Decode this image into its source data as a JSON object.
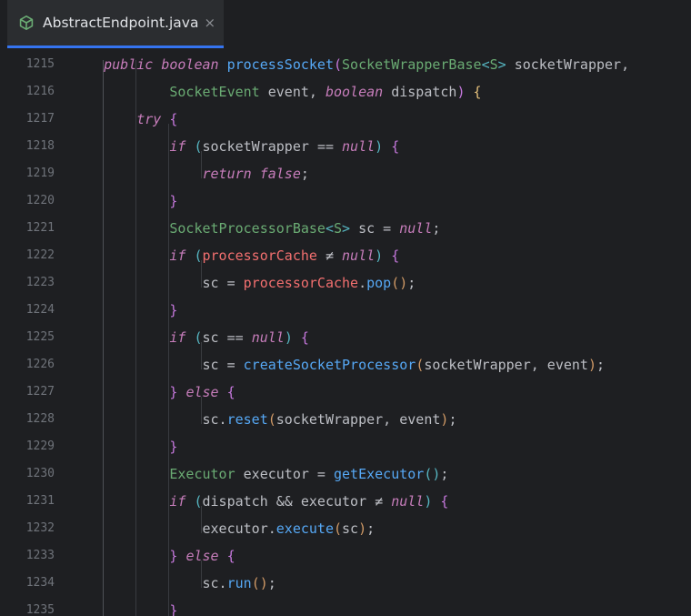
{
  "tab": {
    "icon": "java-class-icon",
    "filename": "AbstractEndpoint.java",
    "close": "×"
  },
  "colors": {
    "background": "#1e1f22",
    "tab_bg": "#2b2d30",
    "tab_active_underline": "#3574f0",
    "line_number": "#6f737a",
    "keyword": "#c77dbb",
    "class_name": "#6aab73",
    "method": "#56a8f5",
    "variable": "#f26f6f"
  },
  "lines": [
    {
      "num": "1215",
      "tokens": [
        [
          "t",
          "    "
        ],
        [
          "kwp",
          "public "
        ],
        [
          "kwp",
          "boolean "
        ],
        [
          "fn",
          "processSocket"
        ],
        [
          "br2",
          "("
        ],
        [
          "cls",
          "SocketWrapperBase"
        ],
        [
          "br3",
          "<"
        ],
        [
          "cls",
          "S"
        ],
        [
          "br3",
          "> "
        ],
        [
          "t",
          "socketWrapper,"
        ]
      ]
    },
    {
      "num": "1216",
      "tokens": [
        [
          "t",
          "            "
        ],
        [
          "cls",
          "SocketEvent "
        ],
        [
          "t",
          "event, "
        ],
        [
          "kwp",
          "boolean "
        ],
        [
          "t",
          "dispatch"
        ],
        [
          "br2",
          ") "
        ],
        [
          "br1",
          "{"
        ]
      ]
    },
    {
      "num": "1217",
      "tokens": [
        [
          "t",
          "        "
        ],
        [
          "kwp",
          "try "
        ],
        [
          "br2",
          "{"
        ]
      ]
    },
    {
      "num": "1218",
      "tokens": [
        [
          "t",
          "            "
        ],
        [
          "kwp",
          "if "
        ],
        [
          "br3",
          "("
        ],
        [
          "t",
          "socketWrapper "
        ],
        [
          "t",
          "== "
        ],
        [
          "kwp",
          "null"
        ],
        [
          "br3",
          ") "
        ],
        [
          "br2",
          "{"
        ]
      ]
    },
    {
      "num": "1219",
      "tokens": [
        [
          "t",
          "                "
        ],
        [
          "kwp",
          "return "
        ],
        [
          "kwp",
          "false"
        ],
        [
          "t",
          ";"
        ]
      ]
    },
    {
      "num": "1220",
      "tokens": [
        [
          "t",
          "            "
        ],
        [
          "br2",
          "}"
        ]
      ]
    },
    {
      "num": "1221",
      "tokens": [
        [
          "t",
          "            "
        ],
        [
          "cls",
          "SocketProcessorBase"
        ],
        [
          "br3",
          "<"
        ],
        [
          "cls",
          "S"
        ],
        [
          "br3",
          "> "
        ],
        [
          "t",
          "sc = "
        ],
        [
          "kwp",
          "null"
        ],
        [
          "t",
          ";"
        ]
      ]
    },
    {
      "num": "1222",
      "tokens": [
        [
          "t",
          "            "
        ],
        [
          "kwp",
          "if "
        ],
        [
          "br3",
          "("
        ],
        [
          "var",
          "processorCache "
        ],
        [
          "t",
          "≠ "
        ],
        [
          "kwp",
          "null"
        ],
        [
          "br3",
          ") "
        ],
        [
          "br2",
          "{"
        ]
      ]
    },
    {
      "num": "1223",
      "tokens": [
        [
          "t",
          "                "
        ],
        [
          "t",
          "sc = "
        ],
        [
          "var",
          "processorCache"
        ],
        [
          "t",
          "."
        ],
        [
          "fn",
          "pop"
        ],
        [
          "br4",
          "()"
        ],
        [
          "t",
          ";"
        ]
      ]
    },
    {
      "num": "1224",
      "tokens": [
        [
          "t",
          "            "
        ],
        [
          "br2",
          "}"
        ]
      ]
    },
    {
      "num": "1225",
      "tokens": [
        [
          "t",
          "            "
        ],
        [
          "kwp",
          "if "
        ],
        [
          "br3",
          "("
        ],
        [
          "t",
          "sc == "
        ],
        [
          "kwp",
          "null"
        ],
        [
          "br3",
          ") "
        ],
        [
          "br2",
          "{"
        ]
      ]
    },
    {
      "num": "1226",
      "tokens": [
        [
          "t",
          "                "
        ],
        [
          "t",
          "sc = "
        ],
        [
          "fn",
          "createSocketProcessor"
        ],
        [
          "br4",
          "("
        ],
        [
          "t",
          "socketWrapper, event"
        ],
        [
          "br4",
          ")"
        ],
        [
          "t",
          ";"
        ]
      ]
    },
    {
      "num": "1227",
      "tokens": [
        [
          "t",
          "            "
        ],
        [
          "br2",
          "} "
        ],
        [
          "kwp",
          "else "
        ],
        [
          "br2",
          "{"
        ]
      ]
    },
    {
      "num": "1228",
      "tokens": [
        [
          "t",
          "                "
        ],
        [
          "t",
          "sc."
        ],
        [
          "fn",
          "reset"
        ],
        [
          "br4",
          "("
        ],
        [
          "t",
          "socketWrapper, event"
        ],
        [
          "br4",
          ")"
        ],
        [
          "t",
          ";"
        ]
      ]
    },
    {
      "num": "1229",
      "tokens": [
        [
          "t",
          "            "
        ],
        [
          "br2",
          "}"
        ]
      ]
    },
    {
      "num": "1230",
      "tokens": [
        [
          "t",
          "            "
        ],
        [
          "cls",
          "Executor "
        ],
        [
          "t",
          "executor = "
        ],
        [
          "fn",
          "getExecutor"
        ],
        [
          "br3",
          "()"
        ],
        [
          "t",
          ";"
        ]
      ]
    },
    {
      "num": "1231",
      "tokens": [
        [
          "t",
          "            "
        ],
        [
          "kwp",
          "if "
        ],
        [
          "br3",
          "("
        ],
        [
          "t",
          "dispatch && "
        ],
        [
          "t",
          "executor ≠ "
        ],
        [
          "kwp",
          "null"
        ],
        [
          "br3",
          ") "
        ],
        [
          "br2",
          "{"
        ]
      ]
    },
    {
      "num": "1232",
      "tokens": [
        [
          "t",
          "                "
        ],
        [
          "t",
          "executor."
        ],
        [
          "fn",
          "execute"
        ],
        [
          "br4",
          "("
        ],
        [
          "t",
          "sc"
        ],
        [
          "br4",
          ")"
        ],
        [
          "t",
          ";"
        ]
      ]
    },
    {
      "num": "1233",
      "tokens": [
        [
          "t",
          "            "
        ],
        [
          "br2",
          "} "
        ],
        [
          "kwp",
          "else "
        ],
        [
          "br2",
          "{"
        ]
      ]
    },
    {
      "num": "1234",
      "tokens": [
        [
          "t",
          "                "
        ],
        [
          "t",
          "sc."
        ],
        [
          "fn",
          "run"
        ],
        [
          "br4",
          "()"
        ],
        [
          "t",
          ";"
        ]
      ]
    },
    {
      "num": "1235",
      "tokens": [
        [
          "t",
          "            "
        ],
        [
          "br2",
          "}"
        ]
      ]
    }
  ]
}
